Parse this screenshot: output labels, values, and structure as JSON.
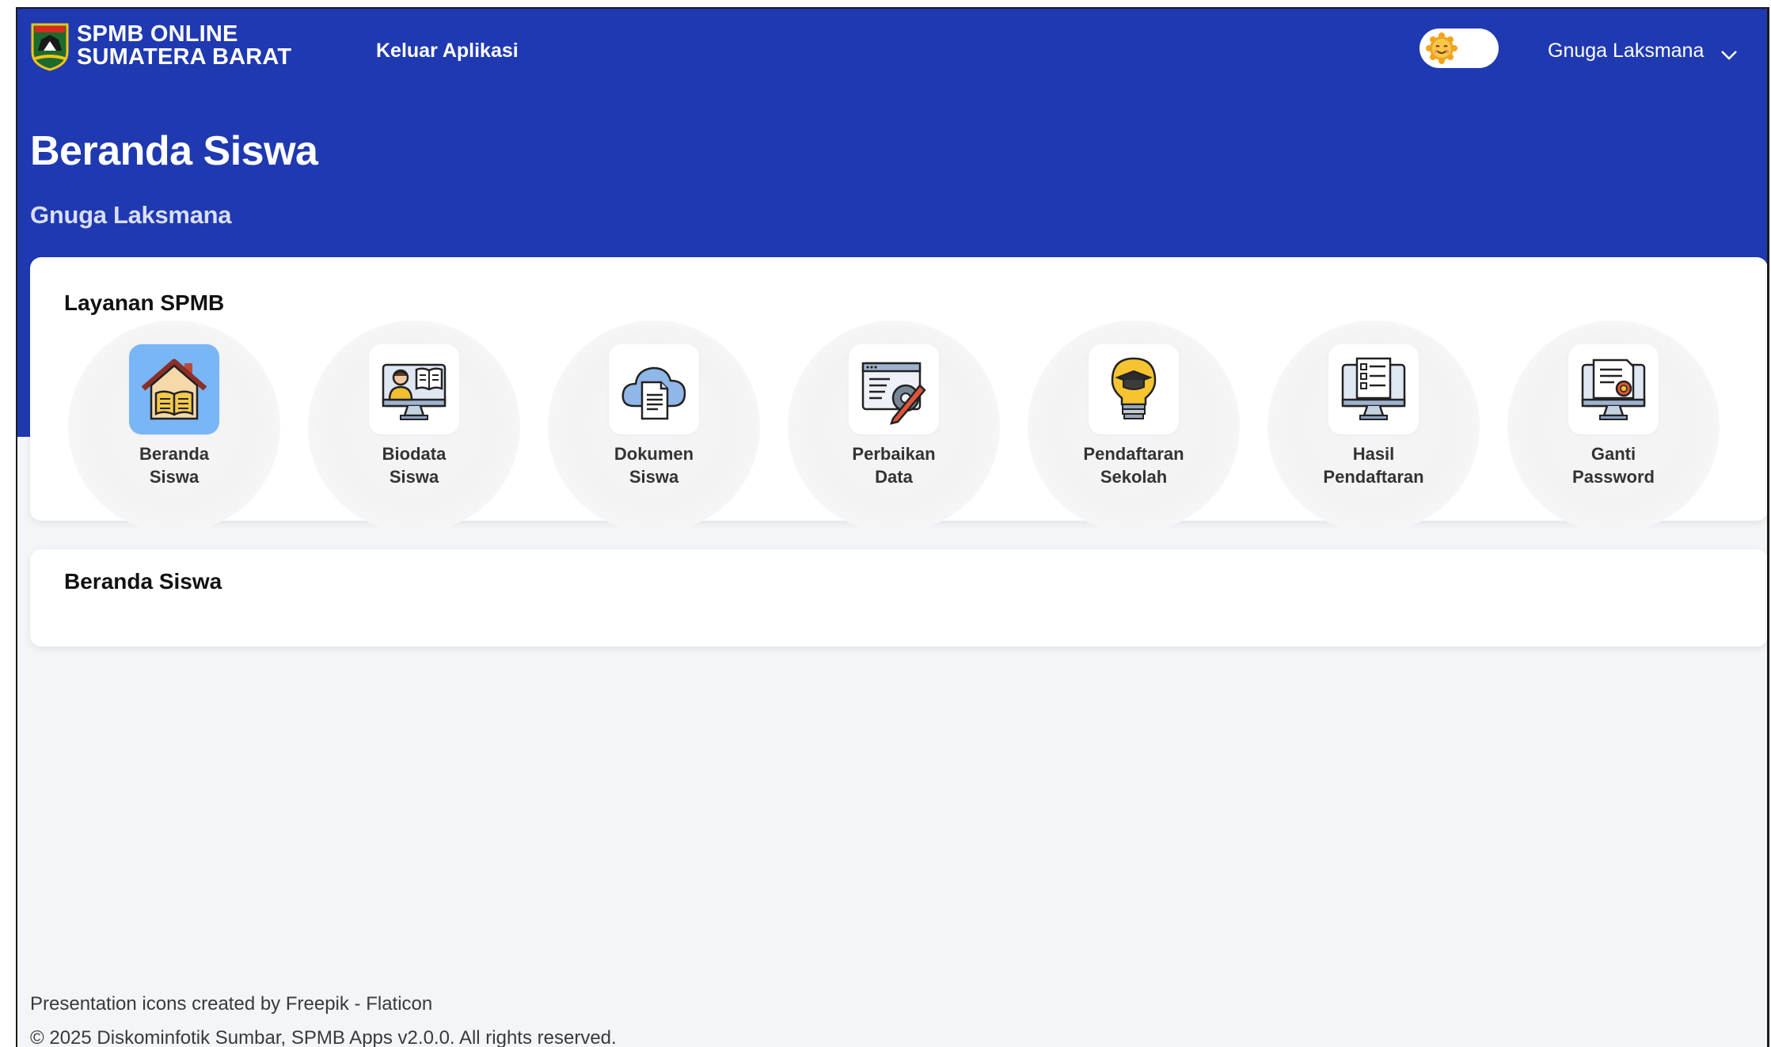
{
  "app": {
    "brand_line1": "SPMB ONLINE",
    "brand_line2": "SUMATERA BARAT"
  },
  "navbar": {
    "logout_label": "Keluar Aplikasi",
    "theme_toggle_icon": "sun-icon",
    "user_name": "Gnuga Laksmana",
    "user_menu_icon": "chevron-down-icon"
  },
  "header": {
    "title": "Beranda Siswa",
    "subtitle": "Gnuga Laksmana"
  },
  "services": {
    "title": "Layanan SPMB",
    "items": [
      {
        "line1": "Beranda",
        "line2": "Siswa",
        "icon": "home-book-icon",
        "active": true
      },
      {
        "line1": "Biodata",
        "line2": "Siswa",
        "icon": "student-monitor-icon",
        "active": false
      },
      {
        "line1": "Dokumen",
        "line2": "Siswa",
        "icon": "cloud-document-icon",
        "active": false
      },
      {
        "line1": "Perbaikan",
        "line2": "Data",
        "icon": "edit-data-icon",
        "active": false
      },
      {
        "line1": "Pendaftaran",
        "line2": "Sekolah",
        "icon": "graduation-bulb-icon",
        "active": false
      },
      {
        "line1": "Hasil",
        "line2": "Pendaftaran",
        "icon": "checklist-monitor-icon",
        "active": false
      },
      {
        "line1": "Ganti",
        "line2": "Password",
        "icon": "certificate-monitor-icon",
        "active": false
      }
    ]
  },
  "home_section": {
    "title": "Beranda Siswa"
  },
  "footer": {
    "credit": "Presentation icons created by Freepik - Flaticon",
    "copyright": "© 2025 Diskominfotik Sumbar, SPMB Apps v2.0.0. All rights reserved."
  },
  "colors": {
    "primary": "#1f39b1",
    "active_tile": "#79b6f5",
    "page_bg": "#f3f5f9"
  }
}
